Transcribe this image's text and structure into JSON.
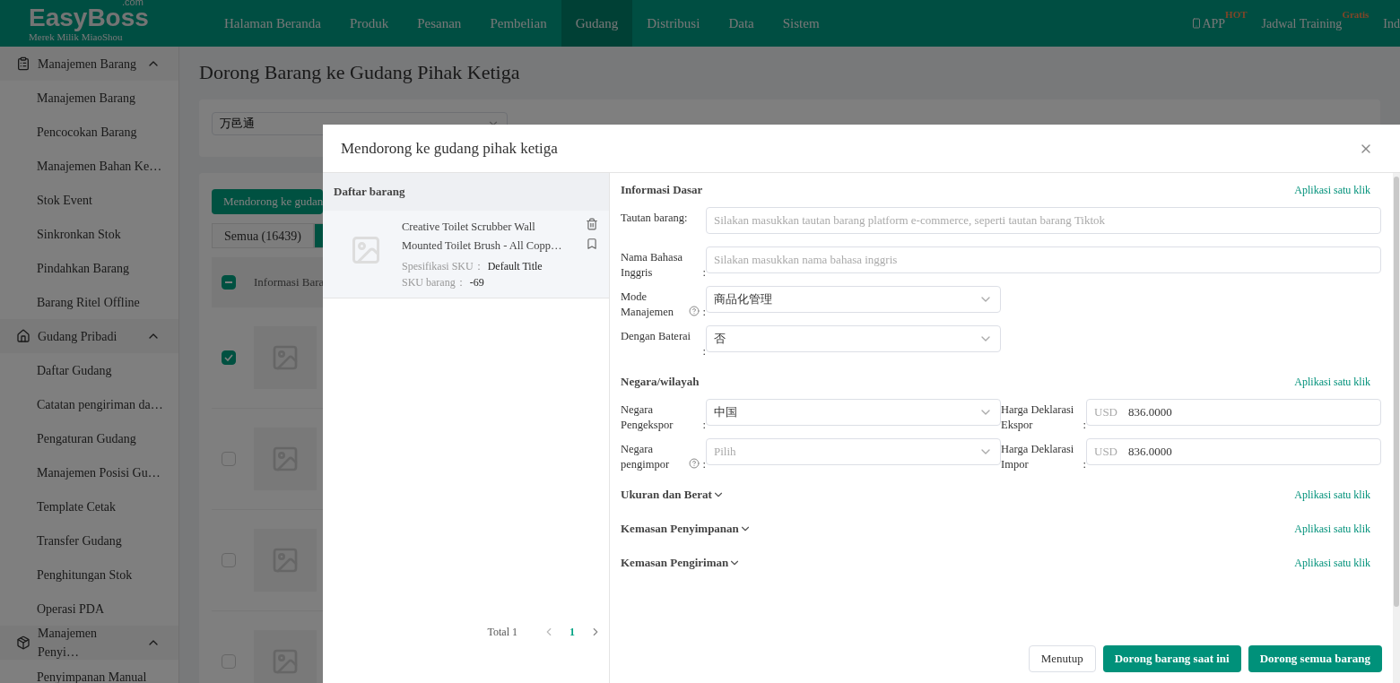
{
  "nav": {
    "logo": "EasyBoss",
    "logo_suffix": ".com",
    "tagline": "Merek Milik MiaoShou",
    "items": [
      {
        "label": "Halaman Beranda",
        "selected": false
      },
      {
        "label": "Produk",
        "selected": false
      },
      {
        "label": "Pesanan",
        "selected": false
      },
      {
        "label": "Pembelian",
        "selected": false
      },
      {
        "label": "Gudang",
        "selected": true
      },
      {
        "label": "Distribusi",
        "selected": false
      },
      {
        "label": "Data",
        "selected": false
      },
      {
        "label": "Sistem",
        "selected": false
      }
    ],
    "right": [
      {
        "label": "APP",
        "badge": "HOT",
        "kind": "app"
      },
      {
        "label": "Jadwal Training",
        "badge": "Gratis",
        "kind": "link"
      },
      {
        "label": "Ind",
        "kind": "link"
      }
    ]
  },
  "sidebar": {
    "groups": [
      {
        "title": "Manajemen Barang",
        "kind": "clipboard",
        "expanded": true,
        "children": [
          {
            "label": "Manajemen Barang"
          },
          {
            "label": "Pencocokan Barang"
          },
          {
            "label": "Manajemen Bahan Ke…"
          },
          {
            "label": "Stok Event"
          },
          {
            "label": "Sinkronkan Stok"
          },
          {
            "label": "Pindahkan Barang"
          },
          {
            "label": "Barang Ritel Offline"
          }
        ]
      },
      {
        "title": "Gudang Pribadi",
        "kind": "house",
        "expanded": true,
        "children": [
          {
            "label": "Daftar Gudang"
          },
          {
            "label": "Catatan pengiriman da…"
          },
          {
            "label": "Pengaturan Gudang"
          },
          {
            "label": "Manajemen Posisi Gu…"
          },
          {
            "label": "Template Cetak"
          },
          {
            "label": "Transfer Gudang"
          },
          {
            "label": "Penghitungan Stok"
          },
          {
            "label": "Operasi PDA"
          }
        ]
      },
      {
        "title": "Manajemen Penyi…",
        "kind": "box",
        "expanded": true,
        "children": [
          {
            "label": "Penyimpanan Manual"
          }
        ]
      }
    ]
  },
  "page": {
    "title": "Dorong Barang ke Gudang Pihak Ketiga",
    "filter_select": "万邑通",
    "push_button": "Mendorong ke gudan",
    "tabs": [
      {
        "label": "Semua (16439)",
        "selected": false
      },
      {
        "selected": true
      }
    ],
    "table": {
      "column_1": "Informasi Bara",
      "header_indeterminate": true,
      "rows": [
        {
          "checked": true
        },
        {
          "checked": false
        },
        {
          "checked": false
        },
        {
          "checked": false
        }
      ]
    }
  },
  "dialog": {
    "title": "Mendorong ke gudang pihak ketiga",
    "list_title": "Daftar barang",
    "products": [
      {
        "name": "Creative Toilet Scrubber Wall Mounted Toilet Brush - All Copp…",
        "spec_label": "Spesifikasi SKU：",
        "spec": "Default Title",
        "sku_label": "SKU barang：",
        "sku": "-69"
      }
    ],
    "pagination": {
      "total": "Total 1",
      "pages": [
        {
          "label": "1",
          "selected": true
        }
      ]
    },
    "sections": [
      {
        "title": "Informasi Dasar",
        "action": "Aplikasi satu klik",
        "expanded": true,
        "fields": [
          {
            "label": "Tautan barang:",
            "kind": "input",
            "placeholder": "Silakan masukkan tautan barang platform e-commerce, seperti tautan barang Tiktok",
            "help": false
          },
          {
            "label": "Nama Bahasa Inggris",
            "colon": ":",
            "kind": "input",
            "placeholder": "Silakan masukkan nama bahasa inggris",
            "help": false
          },
          {
            "label": "Mode Manajemen",
            "colon": ":",
            "kind": "select",
            "value": "商品化管理",
            "help": true
          },
          {
            "label": "Dengan Baterai",
            "colon": ":",
            "kind": "select",
            "value": "否",
            "help": false
          }
        ]
      },
      {
        "title": "Negara/wilayah",
        "action": "Aplikasi satu klik",
        "expanded": true,
        "rows": [
          [
            {
              "label": "Negara Pengekspor",
              "colon": ":",
              "kind": "select",
              "value": "中国",
              "help": false
            },
            {
              "label": "Harga Deklarasi Ekspor",
              "colon": ":",
              "kind": "money",
              "prefix": "USD",
              "value": "836.0000",
              "help": false
            }
          ],
          [
            {
              "label": "Negara pengimpor",
              "colon": ":",
              "kind": "select",
              "placeholder": "Pilih",
              "help": true
            },
            {
              "label": "Harga Deklarasi Impor",
              "colon": ":",
              "kind": "money",
              "prefix": "USD",
              "value": "836.0000",
              "help": false
            }
          ]
        ]
      },
      {
        "title": "Ukuran dan Berat",
        "action": "Aplikasi satu klik",
        "expanded": false
      },
      {
        "title": "Kemasan Penyimpanan",
        "action": "Aplikasi satu klik",
        "expanded": false
      },
      {
        "title": "Kemasan Pengiriman",
        "action": "Aplikasi satu klik",
        "expanded": false
      }
    ],
    "buttons": [
      {
        "label": "Menutup",
        "kind": "default"
      },
      {
        "label": "Dorong barang saat ini",
        "kind": "primary"
      },
      {
        "label": "Dorong semua barang",
        "kind": "primary"
      }
    ]
  }
}
